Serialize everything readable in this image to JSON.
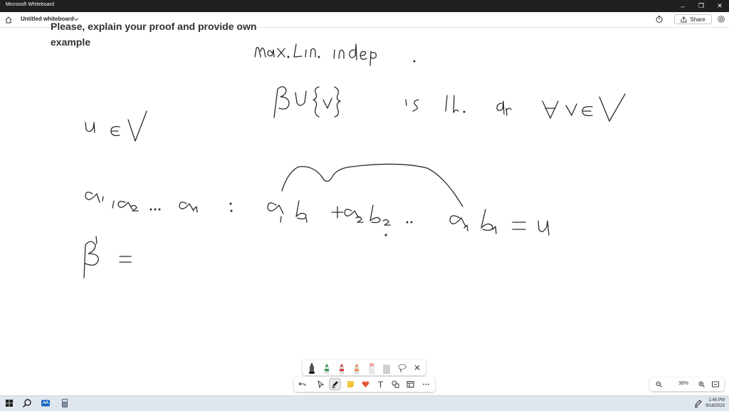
{
  "window": {
    "app_title": "Microsoft Whiteboard",
    "minimize_glyph": "–",
    "restore_glyph": "❐",
    "close_glyph": "✕"
  },
  "appbar": {
    "board_title": "Untitled whiteboard",
    "share_label": "Share"
  },
  "document": {
    "line1": "Please, explain your proof and provide own",
    "line2": "example"
  },
  "pen_tray": {
    "pens": [
      {
        "name": "black",
        "color": "#222222"
      },
      {
        "name": "green",
        "color": "#2e9b4f"
      },
      {
        "name": "red",
        "color": "#d83b3b"
      },
      {
        "name": "orange",
        "color": "#f08a4b"
      },
      {
        "name": "highlighter",
        "color": "#f0a6a6"
      },
      {
        "name": "eraser",
        "color": "#cfcfcf"
      }
    ]
  },
  "zoom": {
    "level": "38%"
  },
  "taskbar": {
    "time": "1:40 PM",
    "date": "9/18/2023"
  },
  "colors": {
    "titlebar": "#202020",
    "taskbar": "#dfe6ee",
    "ink": "#2b2b2b"
  }
}
